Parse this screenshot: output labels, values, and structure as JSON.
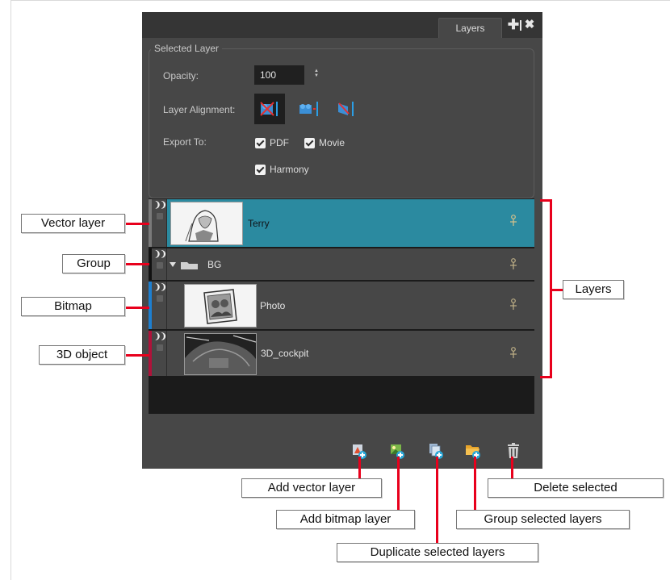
{
  "panel": {
    "tab_label": "Layers",
    "add_symbol": "✚",
    "close_symbol": "✖",
    "group_title": "Selected Layer",
    "opacity_label": "Opacity:",
    "opacity_value": "100",
    "spinner": "▲▼",
    "alignment_label": "Layer Alignment:",
    "export_label": "Export To:",
    "exports": [
      {
        "label": "PDF",
        "checked": true
      },
      {
        "label": "Movie",
        "checked": true
      },
      {
        "label": "Harmony",
        "checked": true
      }
    ],
    "eye_glyph": "❩❩"
  },
  "layers": [
    {
      "name": "Terry",
      "type": "vector",
      "selected": true,
      "color": "#7a7a7a"
    },
    {
      "name": "BG",
      "type": "group",
      "selected": false,
      "color": "#111111"
    },
    {
      "name": "Photo",
      "type": "bitmap",
      "selected": false,
      "color": "#1d7fd0"
    },
    {
      "name": "3D_cockpit",
      "type": "3d",
      "selected": false,
      "color": "#b0123a"
    }
  ],
  "callouts": {
    "vector_layer": "Vector layer",
    "group": "Group",
    "bitmap": "Bitmap",
    "object_3d": "3D object",
    "layers": "Layers",
    "add_vector": "Add vector layer",
    "add_bitmap": "Add bitmap layer",
    "duplicate": "Duplicate selected layers",
    "group_selected": "Group selected layers",
    "delete_selected": "Delete selected"
  },
  "colors": {
    "accent_selected": "#2b8aa0",
    "callout_line": "#e8001c",
    "panel_bg": "#474747"
  }
}
